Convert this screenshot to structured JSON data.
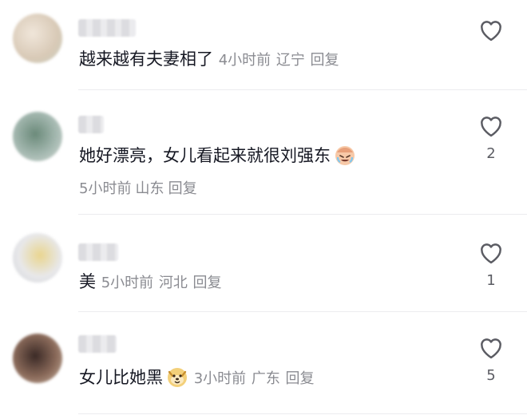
{
  "comments": [
    {
      "text": "越来越有夫妻相了",
      "time": "4小时前",
      "location": "辽宁",
      "reply": "回复",
      "likes": ""
    },
    {
      "text": "她好漂亮，女儿看起来就很刘强东",
      "emoji": "crying-laughing-face-icon",
      "time": "5小时前",
      "location": "山东",
      "reply": "回复",
      "likes": "2"
    },
    {
      "text": "美",
      "time": "5小时前",
      "location": "河北",
      "reply": "回复",
      "likes": "1"
    },
    {
      "text": "女儿比她黑",
      "emoji": "dog-face-emoji-icon",
      "time": "3小时前",
      "location": "广东",
      "reply": "回复",
      "likes": "5"
    }
  ],
  "colors": {
    "meta": "#8a8b91",
    "text": "#161823",
    "heart": "#5b5c63"
  }
}
